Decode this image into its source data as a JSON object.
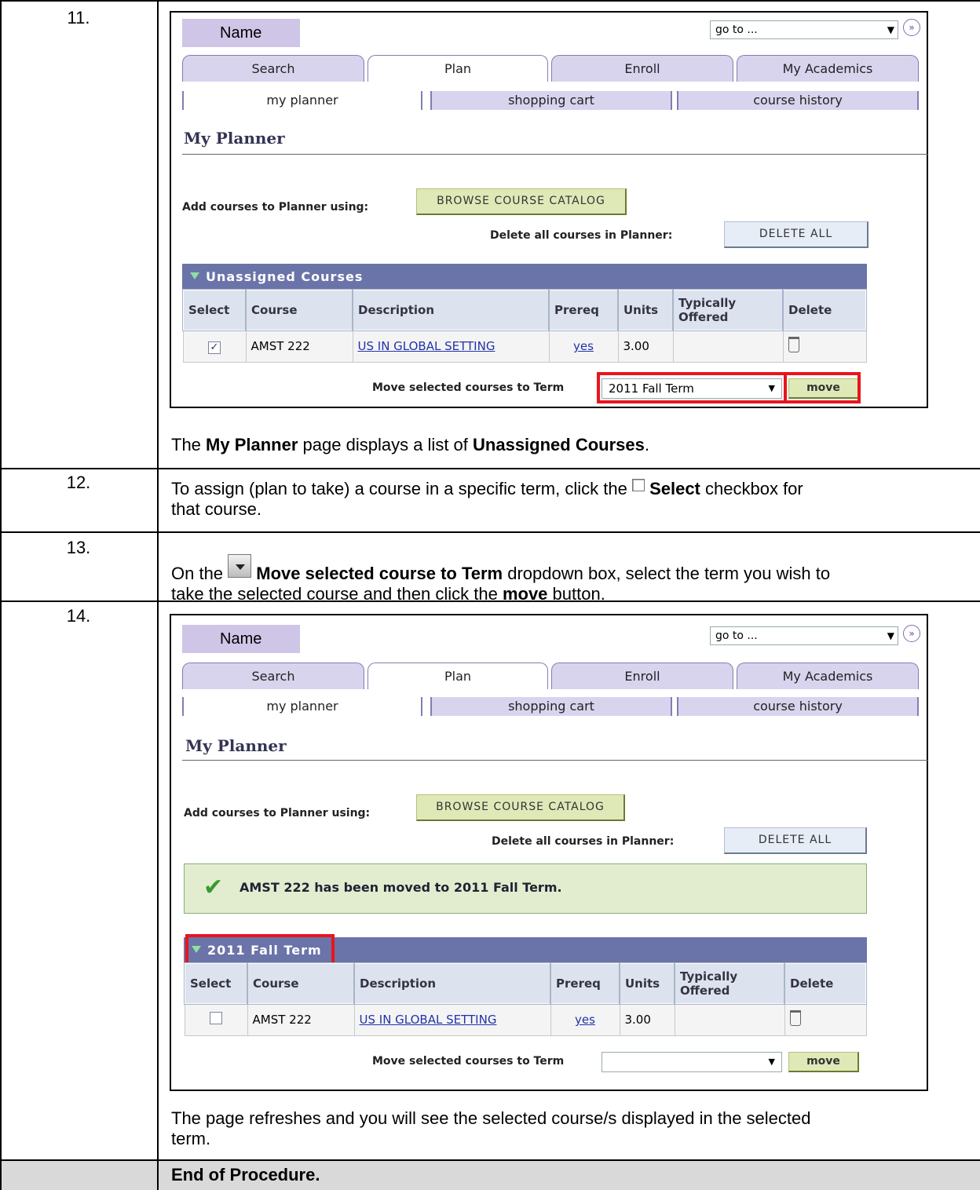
{
  "steps": {
    "s11": {
      "num": "11."
    },
    "s12": {
      "num": "12.",
      "text_a": "To assign (plan to take) a course in a specific term, click the",
      "text_b": "Select",
      "text_c": "checkbox for",
      "text_d": "that course."
    },
    "s13": {
      "num": "13.",
      "text_a": "On the",
      "text_b": "Move selected course to Term",
      "text_c": "dropdown box, select the term you wish to",
      "text_d": "take the selected course and then click the",
      "text_e": "move",
      "text_f": "button."
    },
    "s14": {
      "num": "14."
    },
    "end": {
      "text": "End of Procedure."
    }
  },
  "caption11": {
    "a": "The",
    "b": "My Planner",
    "c": "page displays a list of",
    "d": "Unassigned Courses",
    "e": "."
  },
  "caption14": {
    "line1": "The page refreshes and you will see the selected course/s displayed in the selected",
    "line2": "term."
  },
  "ui": {
    "name_label": "Name",
    "goto_placeholder": "go to ...",
    "tabs": [
      "Search",
      "Plan",
      "Enroll",
      "My Academics"
    ],
    "subtabs": [
      "my planner",
      "shopping cart",
      "course history"
    ],
    "page_title": "My Planner",
    "add_courses_label": "Add courses to Planner using:",
    "browse_button": "BROWSE COURSE CATALOG",
    "delete_all_label": "Delete all courses in Planner:",
    "delete_all_button": "DELETE ALL",
    "columns": [
      "Select",
      "Course",
      "Description",
      "Prereq",
      "Units",
      "Typically Offered",
      "Delete"
    ],
    "move_label": "Move selected courses to Term",
    "move_button": "move"
  },
  "shot1": {
    "grid_title": "Unassigned Courses",
    "row": {
      "checked": "✓",
      "course": "AMST 222",
      "description": "US IN GLOBAL SETTING",
      "prereq": "yes",
      "units": "3.00",
      "offered": ""
    },
    "term_selected": "2011 Fall Term"
  },
  "shot2": {
    "success_msg": "AMST 222 has been moved to 2011 Fall Term.",
    "grid_title": "2011 Fall Term",
    "row": {
      "checked": "",
      "course": "AMST 222",
      "description": "US IN GLOBAL SETTING",
      "prereq": "yes",
      "units": "3.00",
      "offered": ""
    },
    "term_selected": ""
  },
  "colors": {
    "highlight": "#e8151d",
    "grid_header": "#6b74a8",
    "tab_bg": "#d8d4ee"
  }
}
